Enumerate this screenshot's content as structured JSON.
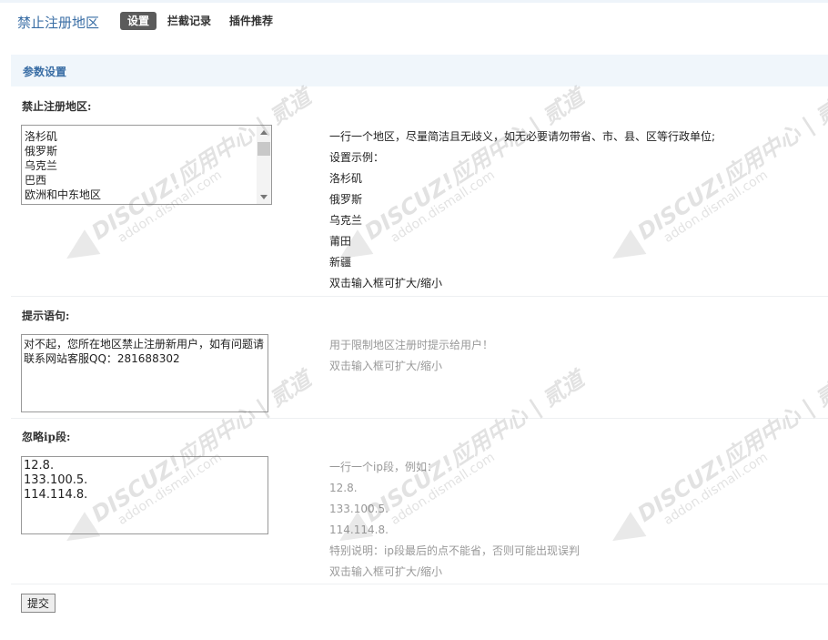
{
  "header": {
    "title": "禁止注册地区",
    "tabs": [
      {
        "label": "设置",
        "active": true
      },
      {
        "label": "拦截记录",
        "active": false
      },
      {
        "label": "插件推荐",
        "active": false
      }
    ]
  },
  "section": {
    "title": "参数设置"
  },
  "regions": {
    "label": "禁止注册地区:",
    "items": [
      "洛杉矶",
      "俄罗斯",
      "乌克兰",
      "巴西",
      "欧洲和中东地区"
    ],
    "help": [
      "一行一个地区，尽量简洁且无歧义，如无必要请勿带省、市、县、区等行政单位;",
      "设置示例：",
      "洛杉矶",
      "俄罗斯",
      "乌克兰",
      "莆田",
      "新疆",
      "双击输入框可扩大/缩小"
    ]
  },
  "message": {
    "label": "提示语句:",
    "value": "对不起，您所在地区禁止注册新用户，如有问题请联系网站客服QQ：281688302",
    "help": [
      "用于限制地区注册时提示给用户！",
      "双击输入框可扩大/缩小"
    ]
  },
  "ignore_ip": {
    "label": "忽略ip段:",
    "value": "12.8.\n133.100.5.\n114.114.8.",
    "help": [
      "一行一个ip段，例如：",
      "12.8.",
      "133.100.5.",
      "114.114.8.",
      "特别说明：ip段最后的点不能省，否则可能出现误判",
      "双击输入框可扩大/缩小"
    ]
  },
  "submit_label": "提交",
  "watermark": {
    "line1": "DISCUZ!应用中心 | 贰道",
    "line2": "addon.dismall.com"
  }
}
